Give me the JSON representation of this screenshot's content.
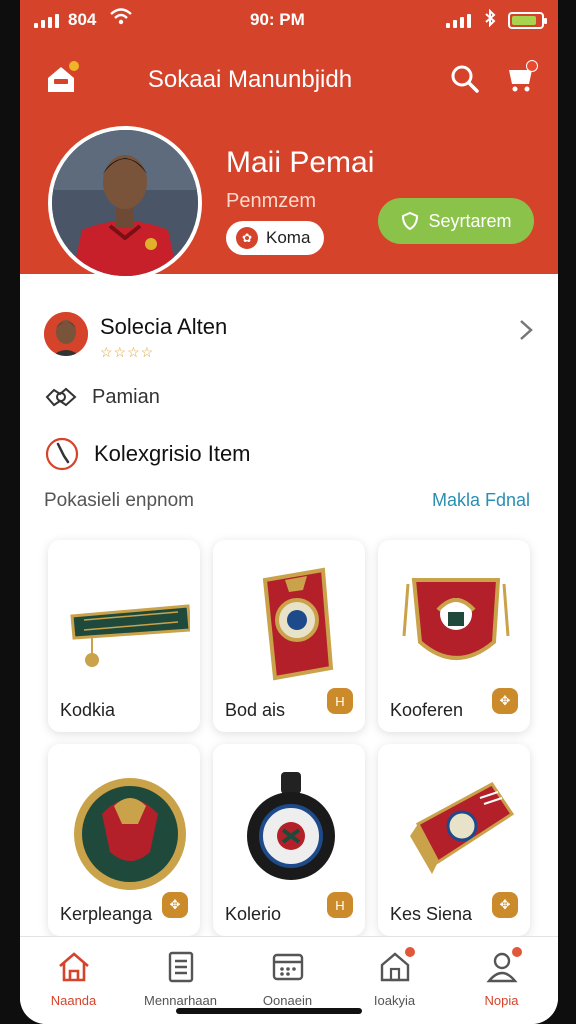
{
  "status": {
    "carrier": "804",
    "time": "90: PM",
    "battery_level": 0.85
  },
  "appbar": {
    "title": "Sokaai Manunbjidh",
    "home_icon": "home-icon",
    "search_icon": "search-icon",
    "cart_icon": "cart-icon"
  },
  "profile": {
    "name": "Maii Pemai",
    "subtitle": "Penmzem",
    "chip_label": "Koma",
    "follow_label": "Seyrtarem"
  },
  "user_row": {
    "name": "Solecia Alten",
    "stars": "☆☆☆☆"
  },
  "menu": {
    "row2": "Pamian",
    "row3": "Kolexgrisio Item"
  },
  "section": {
    "label": "Pokasieli enpnom",
    "link": "Makla Fdnal"
  },
  "items": [
    {
      "label": "Kodkia",
      "badge": "H"
    },
    {
      "label": "Bod ais",
      "badge": "H"
    },
    {
      "label": "Kooferen",
      "badge": "✥"
    },
    {
      "label": "Kerpleanga",
      "badge": "✥"
    },
    {
      "label": "Kolerio",
      "badge": "H"
    },
    {
      "label": "Kes Siena",
      "badge": "✥"
    }
  ],
  "tabs": [
    {
      "label": "Naanda",
      "icon": "home-icon",
      "active": true
    },
    {
      "label": "Mennarhaan",
      "icon": "document-icon"
    },
    {
      "label": "Oonaein",
      "icon": "calendar-icon"
    },
    {
      "label": "Ioakyia",
      "icon": "building-icon"
    },
    {
      "label": "Nopia",
      "icon": "person-icon"
    }
  ],
  "colors": {
    "brand": "#d6432b",
    "follow": "#8bc34a",
    "link": "#2a8fb3",
    "badge": "#cc8b2a"
  }
}
